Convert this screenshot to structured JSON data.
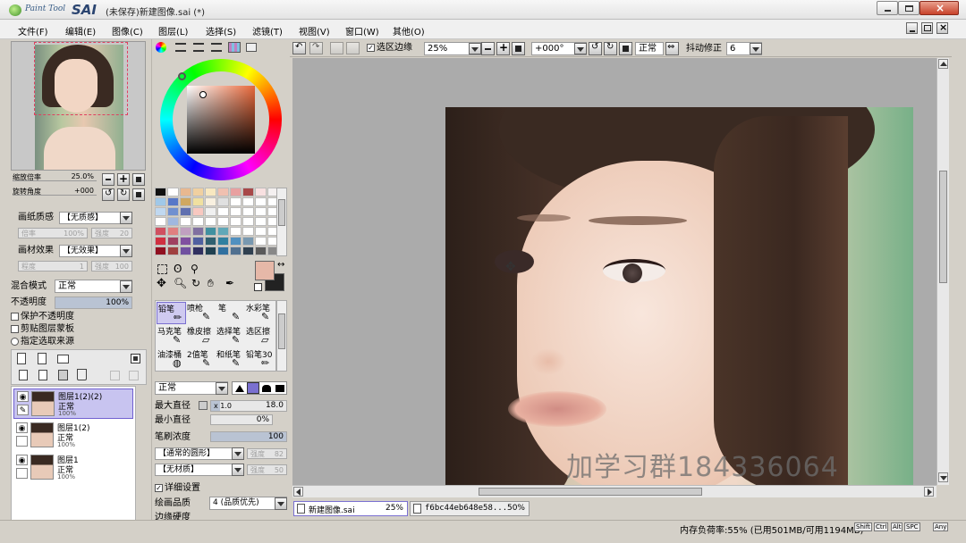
{
  "title": {
    "logo_small": "Paint Tool",
    "logo_big": "SAI",
    "doc": "(未保存)新建图像.sai (*)"
  },
  "menu": [
    {
      "label": "文件(F)"
    },
    {
      "label": "编辑(E)"
    },
    {
      "label": "图像(C)"
    },
    {
      "label": "图层(L)"
    },
    {
      "label": "选择(S)"
    },
    {
      "label": "滤镜(T)"
    },
    {
      "label": "视图(V)"
    },
    {
      "label": "窗口(W)"
    },
    {
      "label": "其他(O)"
    }
  ],
  "navigator": {
    "zoom_label": "缩放倍率",
    "zoom_value": "25.0%",
    "rotate_label": "旋转角度",
    "rotate_value": "+000"
  },
  "props": {
    "paper_label": "画纸质感",
    "paper_value": "【无质感】",
    "paper_scale": "倍率",
    "paper_scale_val": "100%",
    "paper_strength": "强度",
    "paper_strength_val": "20",
    "effect_label": "画材效果",
    "effect_value": "【无效果】",
    "effect_degree": "程度",
    "effect_degree_val": "1",
    "effect_strength": "强度",
    "effect_strength_val": "100",
    "blend_label": "混合模式",
    "blend_value": "正常",
    "opacity_label": "不透明度",
    "opacity_value": "100%",
    "cb_preserve": "保护不透明度",
    "cb_clip": "剪贴图层蒙板",
    "rb_source": "指定选取来源"
  },
  "layers": [
    {
      "name": "图层1(2)(2)",
      "mode": "正常",
      "opacity": "100%",
      "selected": true
    },
    {
      "name": "图层1(2)",
      "mode": "正常",
      "opacity": "100%",
      "selected": false
    },
    {
      "name": "图层1",
      "mode": "正常",
      "opacity": "100%",
      "selected": false
    }
  ],
  "swatches": [
    "#111111",
    "#ffffff",
    "#e8b890",
    "#f0d0a0",
    "#f8e8c0",
    "#f0c0b0",
    "#e8a0a0",
    "#a84848",
    "#f8e0e0",
    "#f4f0f0",
    "#a0c8e8",
    "#5878c8",
    "#d0a860",
    "#f0e0a0",
    "#f8f0e0",
    "#e0e0e0",
    "#ffffff",
    "#ffffff",
    "#ffffff",
    "#ffffff",
    "#c0d8f0",
    "#7090d0",
    "#6070b0",
    "#f8c8c0",
    "#f0f0f0",
    "#ffffff",
    "#ffffff",
    "#ffffff",
    "#ffffff",
    "#ffffff",
    "#ffffff",
    "#a0b8e0",
    "#ffffff",
    "#ffffff",
    "#ffffff",
    "#ffffff",
    "#ffffff",
    "#ffffff",
    "#ffffff",
    "#ffffff",
    "#d05060",
    "#e08080",
    "#c0a0c0",
    "#8070a0",
    "#4090a0",
    "#60a8b8",
    "#ffffff",
    "#ffffff",
    "#ffffff",
    "#ffffff",
    "#d03040",
    "#a04060",
    "#8050a0",
    "#5060a0",
    "#306070",
    "#3080a0",
    "#5090c0",
    "#7898b0",
    "#ffffff",
    "#ffffff",
    "#901020",
    "#a04040",
    "#7050a0",
    "#303060",
    "#204050",
    "#3070a0",
    "#507090",
    "#304050",
    "#5a5a5a",
    "#888888"
  ],
  "brush_tools": [
    {
      "label": "铅笔"
    },
    {
      "label": "喷枪"
    },
    {
      "label": "笔"
    },
    {
      "label": "水彩笔"
    },
    {
      "label": "马克笔"
    },
    {
      "label": "橡皮擦"
    },
    {
      "label": "选择笔"
    },
    {
      "label": "选区擦"
    },
    {
      "label": "油漆桶"
    },
    {
      "label": "2值笔"
    },
    {
      "label": "和纸笔"
    },
    {
      "label": "铅笔30"
    }
  ],
  "brush": {
    "mode": "正常",
    "max_label": "最大直径",
    "max_mult": "x 1.0",
    "max_val": "18.0",
    "min_label": "最小直径",
    "min_val": "0%",
    "density_label": "笔刷浓度",
    "density_val": "100",
    "shape": "【通常的圆形】",
    "shape_strength": "强度",
    "shape_strength_val": "82",
    "texture": "【无材质】",
    "texture_strength": "强度",
    "texture_strength_val": "50",
    "detail_label": "详细设置",
    "quality_label": "绘画品质",
    "quality_value": "4 (品质优先)",
    "edge_label": "边缘硬度"
  },
  "canvas_toolbar": {
    "sel_edge": "选区边缘",
    "zoom": "25%",
    "angle": "+000°",
    "mode": "正常",
    "stab_label": "抖动修正",
    "stab_value": "6"
  },
  "watermark": "加学习群184336064",
  "tabs": [
    {
      "name": "新建图像.sai",
      "pct": "25%"
    },
    {
      "name": "f6bc44eb648e58...",
      "pct": "50%"
    }
  ],
  "status": {
    "memory": "内存负荷率:55% (已用501MB/可用1194MB)",
    "keys": [
      "Shift",
      "Ctrl",
      "Alt",
      "SPC",
      "Any"
    ]
  },
  "colors": {
    "accent": "#b9c3d3",
    "selected_layer": "#c8c4f0",
    "canvas_bg": "#ababab",
    "primary_color": "#e6b8a8",
    "secondary_color": "#222222"
  }
}
